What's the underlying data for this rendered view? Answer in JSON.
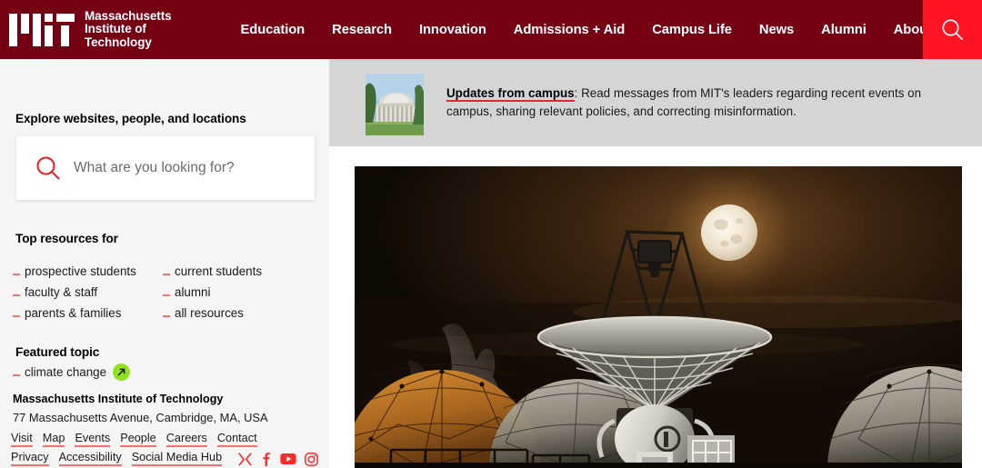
{
  "header": {
    "logo_alt": "MIT",
    "logo_words": [
      "Massachusetts",
      "Institute of",
      "Technology"
    ],
    "nav": [
      {
        "label": "Education"
      },
      {
        "label": "Research"
      },
      {
        "label": "Innovation"
      },
      {
        "label": "Admissions + Aid"
      },
      {
        "label": "Campus Life"
      },
      {
        "label": "News"
      },
      {
        "label": "Alumni"
      },
      {
        "label": "About MIT"
      }
    ],
    "search_icon": "search-icon",
    "colors": {
      "bar": "#750014",
      "search_button": "#ff1423"
    }
  },
  "sidebar": {
    "explore_heading": "Explore websites, people, and locations",
    "search": {
      "placeholder": "What are you looking for?",
      "value": "",
      "icon": "search-icon"
    },
    "top_resources_heading": "Top resources for",
    "top_resources": [
      {
        "label": "prospective students"
      },
      {
        "label": "current students"
      },
      {
        "label": "faculty & staff"
      },
      {
        "label": "alumni"
      },
      {
        "label": "parents & families"
      },
      {
        "label": "all resources"
      }
    ],
    "featured_heading": "Featured topic",
    "featured_topic": {
      "label": "climate change",
      "badge_icon": "arrow-up-right-icon"
    },
    "address_title": "Massachusetts Institute of Technology",
    "address_line": "77 Massachusetts Avenue, Cambridge, MA, USA",
    "footer_links_row1": [
      {
        "label": "Visit"
      },
      {
        "label": "Map"
      },
      {
        "label": "Events"
      },
      {
        "label": "People"
      },
      {
        "label": "Careers"
      },
      {
        "label": "Contact"
      }
    ],
    "footer_links_row2": [
      {
        "label": "Privacy"
      },
      {
        "label": "Accessibility"
      },
      {
        "label": "Social Media Hub"
      }
    ],
    "social": [
      {
        "name": "x-twitter-icon"
      },
      {
        "name": "facebook-icon"
      },
      {
        "name": "youtube-icon"
      },
      {
        "name": "instagram-icon"
      }
    ],
    "colors": {
      "panel": "#f5f5f5",
      "marker": "#f4716e",
      "badge": "#8fe321"
    }
  },
  "content": {
    "banner": {
      "thumb_alt": "MIT Great Dome",
      "link_text": "Updates from campus",
      "body_text": ": Read messages from MIT's leaders regarding recent events on campus, sharing relevant policies, and correcting misinformation.",
      "background": "#d5d5d5"
    },
    "hero": {
      "alt": "Radio telescope dish at night with full moon and geodesic radomes"
    }
  }
}
